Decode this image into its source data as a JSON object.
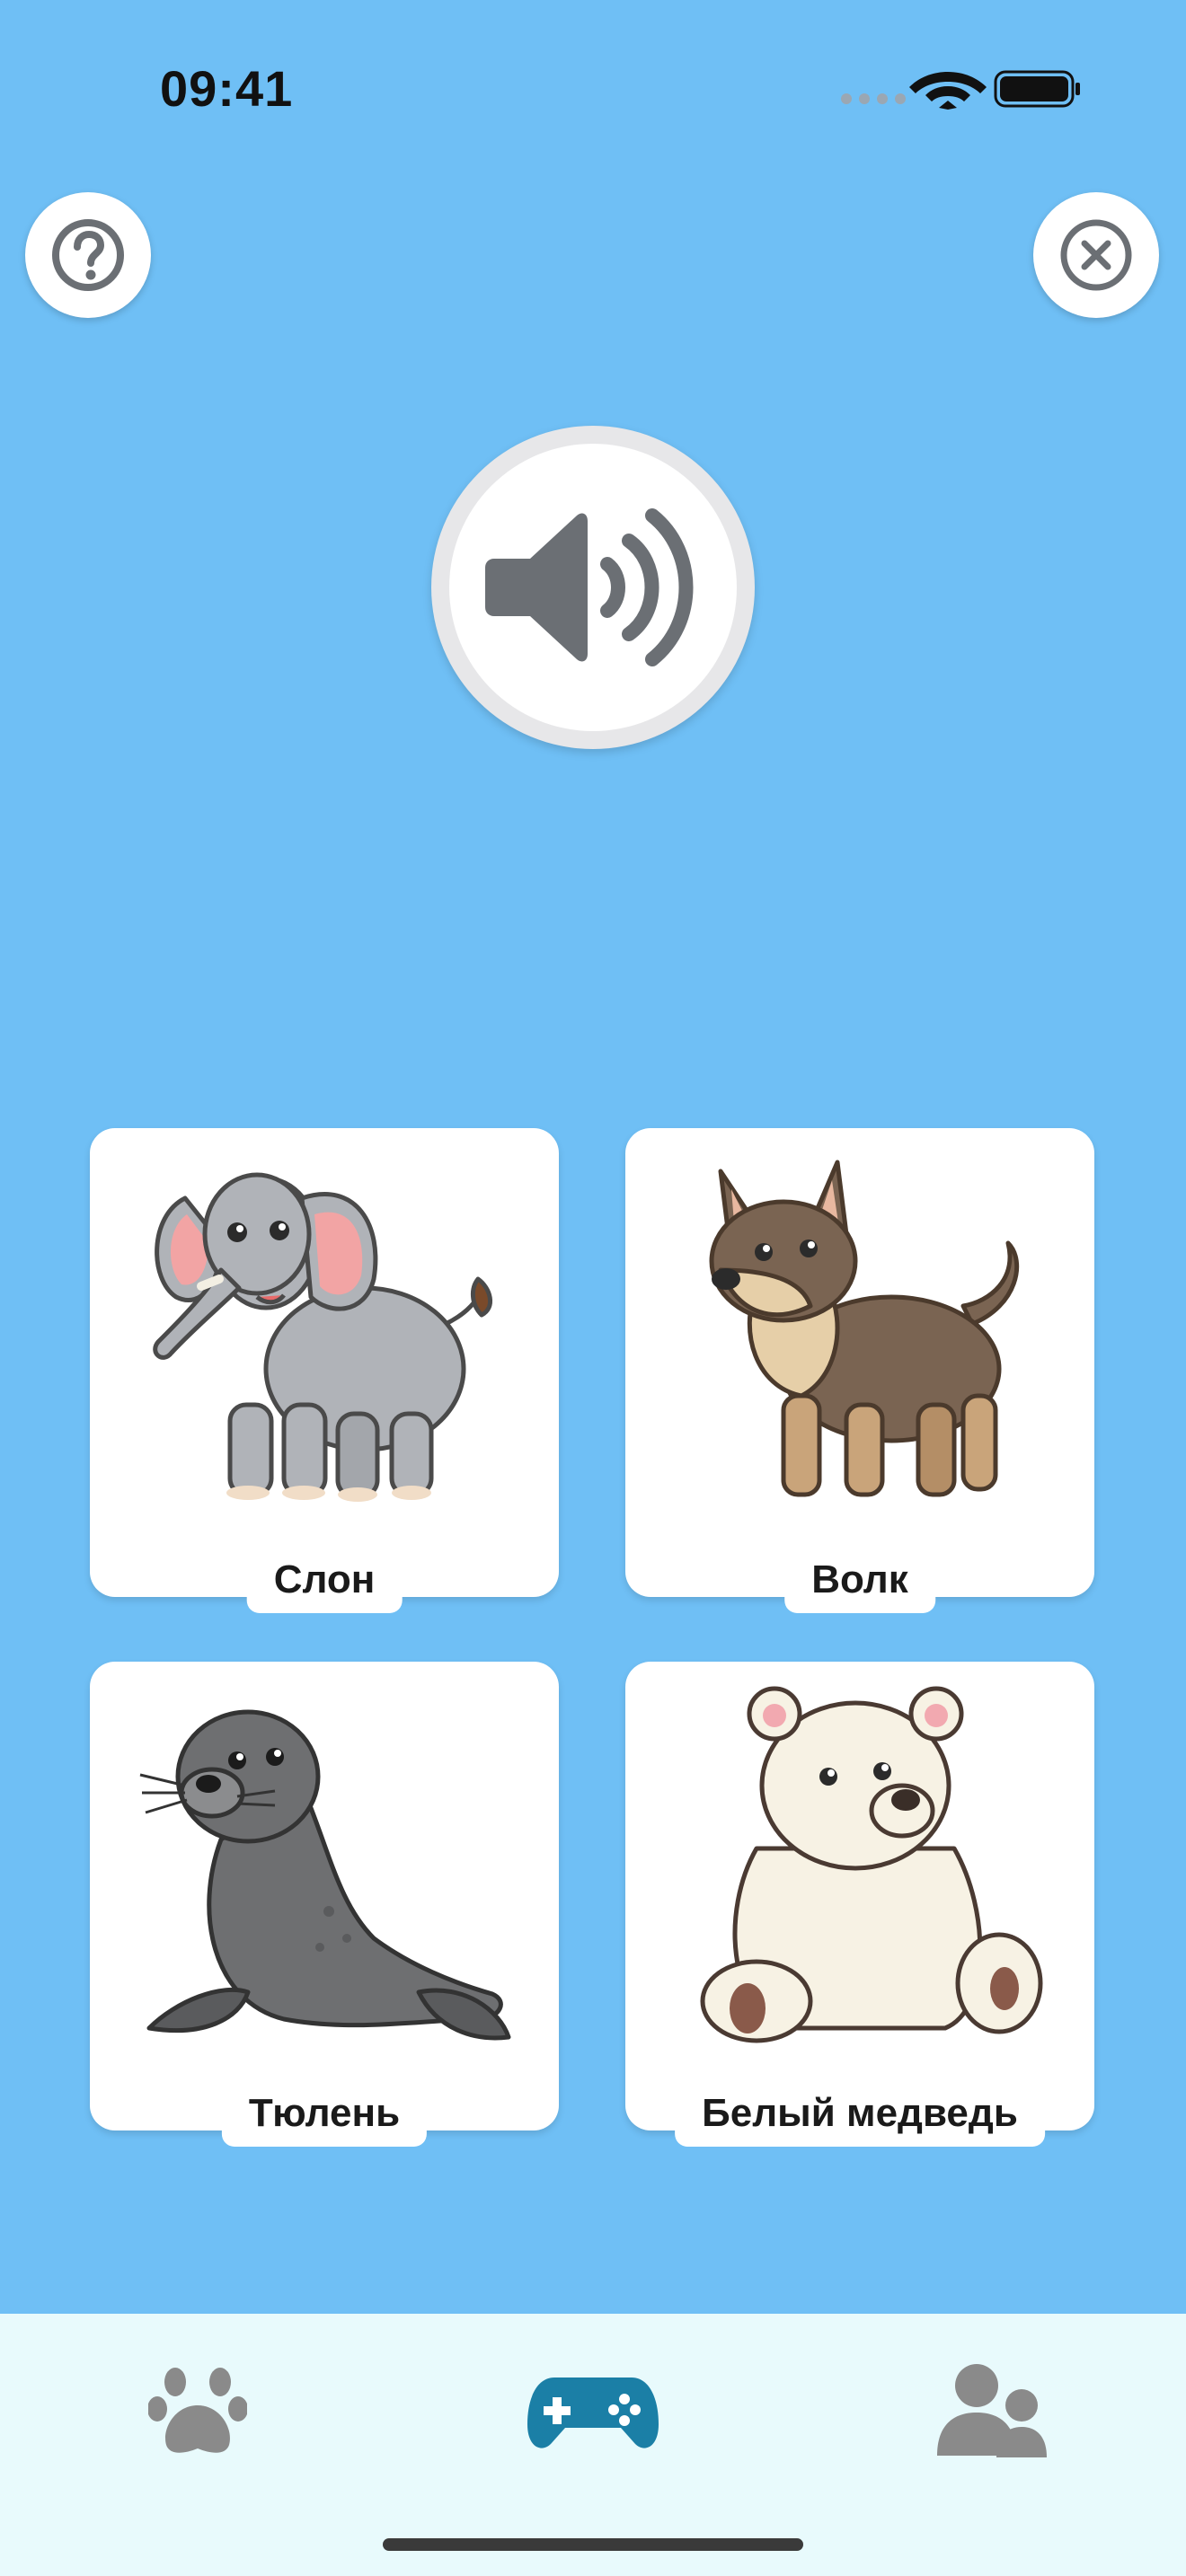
{
  "status_bar": {
    "time": "09:41"
  },
  "header": {
    "help_icon": "question-circle-icon",
    "close_icon": "close-circle-icon"
  },
  "play_sound": {
    "icon": "speaker-icon"
  },
  "cards": [
    {
      "label": "Слон"
    },
    {
      "label": "Волк"
    },
    {
      "label": "Тюлень"
    },
    {
      "label": "Белый медведь"
    }
  ],
  "tabbar": {
    "tabs": [
      {
        "icon": "paw-icon",
        "active": false
      },
      {
        "icon": "gamepad-icon",
        "active": true
      },
      {
        "icon": "users-icon",
        "active": false
      }
    ]
  },
  "colors": {
    "background": "#6fbff5",
    "tabbar": "#e8fafc",
    "active_tab": "#1b7fa6",
    "inactive_tab": "#8a8a8a",
    "icon_gray": "#6b6f74"
  }
}
